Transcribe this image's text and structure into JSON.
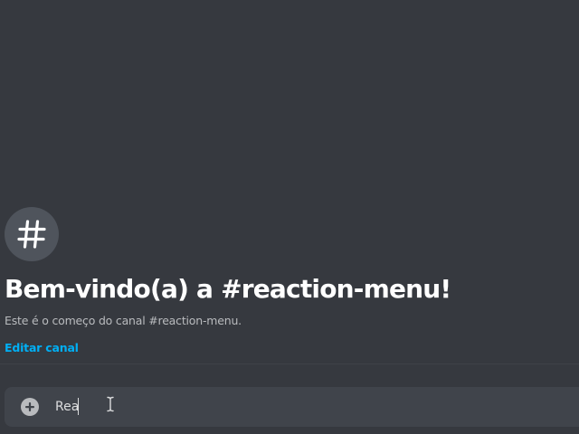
{
  "channel": {
    "icon": "hashtag-icon",
    "welcome_title": "Bem-vindo(a) a #reaction-menu!",
    "welcome_subtitle": "Este é o começo do canal #reaction-menu.",
    "edit_link": "Editar canal"
  },
  "composer": {
    "attach_icon": "plus-circle-icon",
    "input_value": "Rea"
  },
  "colors": {
    "background": "#36393f",
    "avatar_bg": "#4f545c",
    "composer_bg": "#40444b",
    "link": "#00aff4",
    "title": "#ffffff",
    "subtitle": "#b9bbbe"
  }
}
